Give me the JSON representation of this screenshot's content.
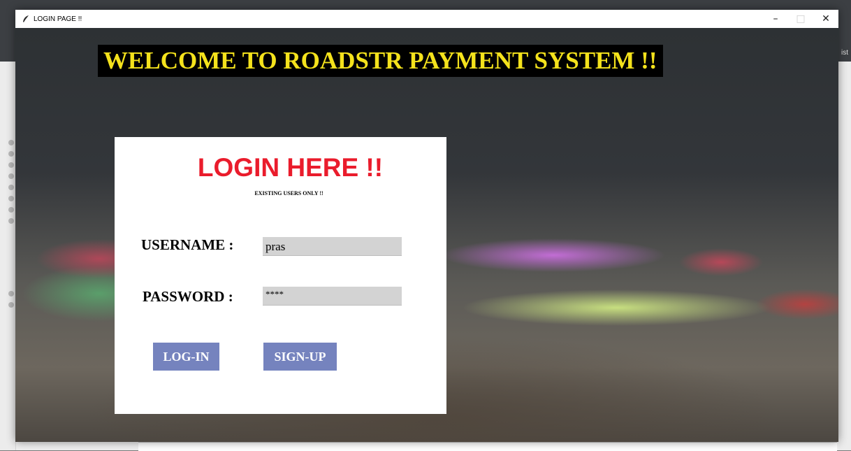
{
  "window": {
    "title": "LOGIN PAGE !!",
    "controls": {
      "minimize": "–",
      "maximize": "□",
      "close": "✕"
    }
  },
  "background_partial_text": "ist",
  "banner": {
    "text": "WELCOME TO ROADSTR PAYMENT SYSTEM !!"
  },
  "login_panel": {
    "title": "LOGIN HERE !!",
    "subtitle": "EXISTING USERS ONLY !!",
    "username": {
      "label": "USERNAME :",
      "value": "pras"
    },
    "password": {
      "label": "PASSWORD :",
      "value": "****"
    },
    "login_button": "LOG-IN",
    "signup_button": "SIGN-UP"
  },
  "colors": {
    "banner_text": "#f4e21c",
    "banner_bg": "#000000",
    "login_title": "#ea1c2c",
    "button_bg": "#7583be",
    "input_bg": "#d3d3d3"
  }
}
